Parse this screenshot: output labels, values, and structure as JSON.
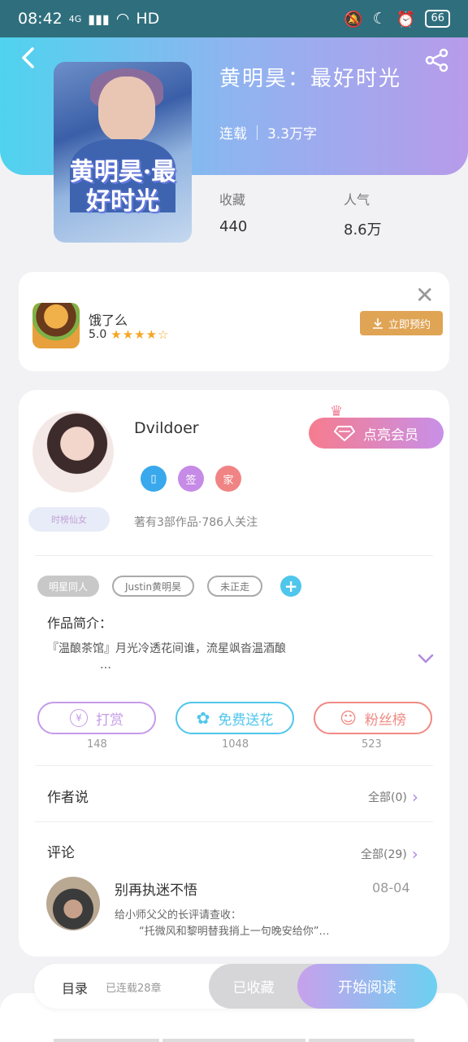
{
  "status_bar": {
    "time": "08:42",
    "network": "4G",
    "hd": "HD",
    "battery": "66"
  },
  "book": {
    "title": "黄明昊：最好时光",
    "cover_title": "黄明昊·最好时光",
    "status": "连载",
    "word_count": "3.3万字",
    "stats": [
      {
        "label": "收藏",
        "value": "440"
      },
      {
        "label": "人气",
        "value": "8.6万"
      }
    ]
  },
  "ad": {
    "name": "饿了么",
    "rating": "5.0",
    "stars": "★★★★☆",
    "button": "立即预约"
  },
  "author": {
    "name": "Dvildoer",
    "badges": [
      {
        "icon": "phone-icon",
        "text": "▯",
        "color": "#3aa8ec"
      },
      {
        "icon": "sign-icon",
        "text": "签",
        "color": "#c68be6"
      },
      {
        "icon": "home-icon",
        "text": "家",
        "color": "#f08484"
      }
    ],
    "vip_button": "点亮会员",
    "tag": "时榜仙女",
    "stats_text": "著有3部作品·786人关注"
  },
  "tags": [
    "明星同人",
    "Justin黄明昊",
    "未正走"
  ],
  "intro": {
    "title": "作品简介：",
    "text": "『温酿茶馆』月光冷透花间谁，流星飒沓温酒酿",
    "ellipsis": "…"
  },
  "actions": [
    {
      "label": "打赏",
      "count": "148",
      "color": "#c59be8",
      "icon": "yen-icon",
      "glyph": "¥"
    },
    {
      "label": "免费送花",
      "count": "1048",
      "color": "#4fc6ec",
      "icon": "flower-icon",
      "glyph": "✿"
    },
    {
      "label": "粉丝榜",
      "count": "523",
      "color": "#f08a84",
      "icon": "fans-icon",
      "glyph": "☺"
    }
  ],
  "author_says": {
    "title": "作者说",
    "link": "全部(0)"
  },
  "comments": {
    "title": "评论",
    "link": "全部(29)",
    "first": {
      "name": "别再执迷不悟",
      "date": "08-04",
      "line1": "给小师父父的长评请查收：",
      "line2": "“托微风和黎明替我捎上一句晚安给你”…"
    }
  },
  "bottom": {
    "toc": "目录",
    "toc_sub": "已连载28章",
    "collected": "已收藏",
    "read": "开始阅读"
  }
}
